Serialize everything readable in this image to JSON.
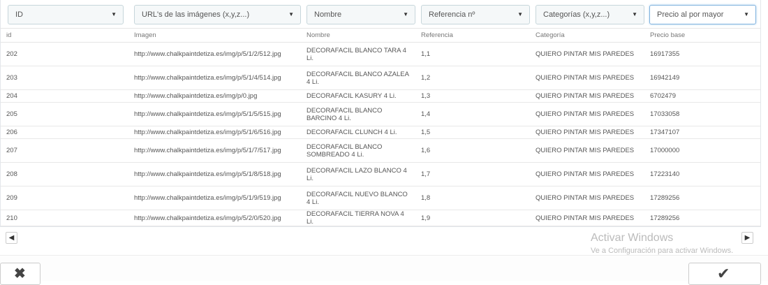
{
  "selectors": [
    {
      "label": "ID"
    },
    {
      "label": "URL's de las imágenes (x,y,z...)"
    },
    {
      "label": "Nombre"
    },
    {
      "label": "Referencia nº"
    },
    {
      "label": "Categorías (x,y,z...)"
    },
    {
      "label": "Precio al por mayor"
    }
  ],
  "columns": [
    "id",
    "Imagen",
    "Nombre",
    "Referencia",
    "Categoría",
    "Precio base"
  ],
  "rows": [
    {
      "id": "202",
      "imagen": "http://www.chalkpaintdetiza.es/img/p/5/1/2/512.jpg",
      "nombre": "DECORAFACIL BLANCO TARA 4 Li.",
      "referencia": "1,1",
      "categoria": "QUIERO PINTAR MIS PAREDES",
      "precio": "16917355"
    },
    {
      "id": "203",
      "imagen": "http://www.chalkpaintdetiza.es/img/p/5/1/4/514.jpg",
      "nombre": "DECORAFACIL BLANCO AZALEA 4 Li.",
      "referencia": "1,2",
      "categoria": "QUIERO PINTAR MIS PAREDES",
      "precio": "16942149"
    },
    {
      "id": "204",
      "imagen": "http://www.chalkpaintdetiza.es/img/p/0.jpg",
      "nombre": "DECORAFACIL KASURY 4 Li.",
      "referencia": "1,3",
      "categoria": "QUIERO PINTAR MIS PAREDES",
      "precio": "6702479"
    },
    {
      "id": "205",
      "imagen": "http://www.chalkpaintdetiza.es/img/p/5/1/5/515.jpg",
      "nombre": "DECORAFACIL BLANCO BARCINO 4 Li.",
      "referencia": "1,4",
      "categoria": "QUIERO PINTAR MIS PAREDES",
      "precio": "17033058"
    },
    {
      "id": "206",
      "imagen": "http://www.chalkpaintdetiza.es/img/p/5/1/6/516.jpg",
      "nombre": "DECORAFACIL CLUNCH 4 Li.",
      "referencia": "1,5",
      "categoria": "QUIERO PINTAR MIS PAREDES",
      "precio": "17347107"
    },
    {
      "id": "207",
      "imagen": "http://www.chalkpaintdetiza.es/img/p/5/1/7/517.jpg",
      "nombre": "DECORAFACIL BLANCO SOMBREADO 4 Li.",
      "referencia": "1,6",
      "categoria": "QUIERO PINTAR MIS PAREDES",
      "precio": "17000000"
    },
    {
      "id": "208",
      "imagen": "http://www.chalkpaintdetiza.es/img/p/5/1/8/518.jpg",
      "nombre": "DECORAFACIL LAZO BLANCO 4 Li.",
      "referencia": "1,7",
      "categoria": "QUIERO PINTAR MIS PAREDES",
      "precio": "17223140"
    },
    {
      "id": "209",
      "imagen": "http://www.chalkpaintdetiza.es/img/p/5/1/9/519.jpg",
      "nombre": "DECORAFACIL NUEVO BLANCO 4 Li.",
      "referencia": "1,8",
      "categoria": "QUIERO PINTAR MIS PAREDES",
      "precio": "17289256"
    },
    {
      "id": "210",
      "imagen": "http://www.chalkpaintdetiza.es/img/p/5/2/0/520.jpg",
      "nombre": "DECORAFACIL TIERRA NOVA 4 Li.",
      "referencia": "1,9",
      "categoria": "QUIERO PINTAR MIS PAREDES",
      "precio": "17289256"
    }
  ],
  "watermark": {
    "title": "Activar Windows",
    "subtitle": "Ve a Configuración para activar Windows."
  },
  "icons": {
    "scroll_left": "chevron-left-circle-icon",
    "scroll_right": "chevron-right-circle-icon",
    "cancel": "close-icon",
    "confirm": "checkmark-icon"
  },
  "colors": {
    "active_select_border": "#7fb2de",
    "select_border": "#c7d6db"
  }
}
